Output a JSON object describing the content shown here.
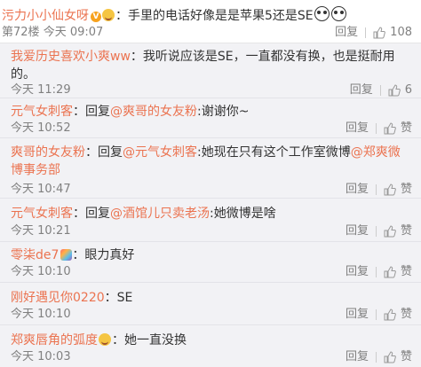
{
  "main_comment": {
    "username": "污力小小仙女呀",
    "separator": "：",
    "text": "手里的电话好像是是苹果5还是SE",
    "floor": "第72楼",
    "time": "今天 09:07",
    "reply_label": "回复",
    "like_count": "108"
  },
  "replies": [
    {
      "username": "我爱历史喜欢小爽ww",
      "separator": "：",
      "text": "我听说应该是SE，一直都没有换，也是挺耐用的。",
      "time": "今天 11:29",
      "reply_label": "回复",
      "like_label": "6"
    },
    {
      "username": "元气女刺客",
      "separator": "：回复",
      "mention": "@爽哥的女友粉",
      "text": ":谢谢你~",
      "time": "今天 10:52",
      "reply_label": "回复",
      "like_label": "赞"
    },
    {
      "username": "爽哥的女友粉",
      "separator": "：回复",
      "mention": "@元气女刺客",
      "text": ":她现在只有这个工作室微博",
      "mention2": "@郑爽微博事务部",
      "time": "今天 10:47",
      "reply_label": "回复",
      "like_label": "赞"
    },
    {
      "username": "元气女刺客",
      "separator": "：回复",
      "mention": "@酒馆儿只卖老汤",
      "text": ":她微博是啥",
      "time": "今天 10:21",
      "reply_label": "回复",
      "like_label": "赞"
    },
    {
      "username": "零柒de7",
      "separator": "：",
      "text": "眼力真好",
      "time": "今天 10:10",
      "reply_label": "回复",
      "like_label": "赞"
    },
    {
      "username": "刚好遇见你0220",
      "separator": "：",
      "text": "SE",
      "time": "今天 10:10",
      "reply_label": "回复",
      "like_label": "赞"
    },
    {
      "username": "郑爽唇角的弧度",
      "separator": "：",
      "text": "她一直没换",
      "time": "今天 10:03",
      "reply_label": "回复",
      "like_label": "赞"
    }
  ],
  "icons": {
    "verified": "v-badge-icon",
    "like": "thumb-up-icon",
    "emoji": "emoji-icon",
    "member": "member-icon"
  },
  "colors": {
    "username": "#eb7350",
    "text": "#333333",
    "meta": "#808080",
    "reply_bg": "#f2f2f5"
  }
}
